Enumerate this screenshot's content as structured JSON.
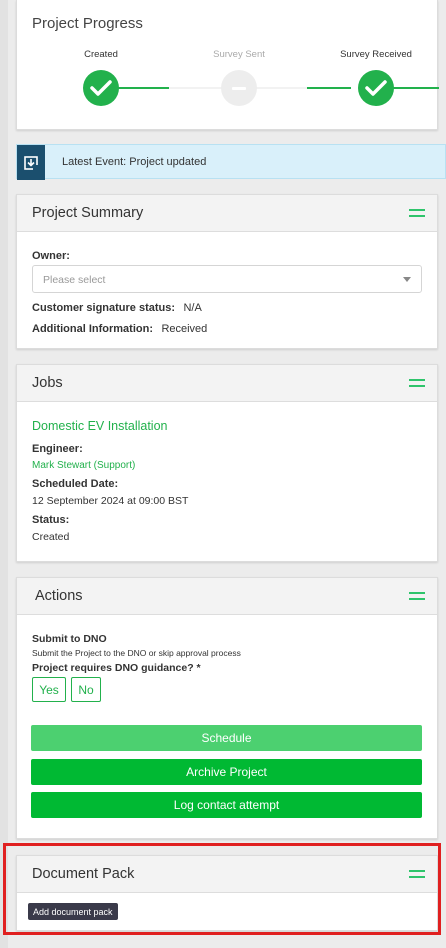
{
  "progress": {
    "title": "Project Progress",
    "steps": [
      {
        "label": "Created",
        "state": "done"
      },
      {
        "label": "Survey Sent",
        "state": "pending"
      },
      {
        "label": "Survey Received",
        "state": "done"
      }
    ]
  },
  "event": {
    "text": "Latest Event: Project updated"
  },
  "summary": {
    "title": "Project Summary",
    "owner_label": "Owner:",
    "owner_placeholder": "Please select",
    "signature_label": "Customer signature status:",
    "signature_value": "N/A",
    "info_label": "Additional Information:",
    "info_value": "Received"
  },
  "jobs": {
    "title": "Jobs",
    "job_name": "Domestic EV Installation",
    "engineer_label": "Engineer:",
    "engineer_value": "Mark Stewart (Support)",
    "date_label": "Scheduled Date:",
    "date_value": "12 September 2024 at 09:00 BST",
    "status_label": "Status:",
    "status_value": "Created"
  },
  "actions": {
    "title": "Actions",
    "dno_title": "Submit to DNO",
    "dno_desc": "Submit the Project to the DNO or skip approval process",
    "dno_question": "Project requires DNO guidance? *",
    "yes_label": "Yes",
    "no_label": "No",
    "schedule_label": "Schedule",
    "archive_label": "Archive Project",
    "log_label": "Log contact attempt"
  },
  "docpack": {
    "title": "Document Pack",
    "add_label": "Add document pack"
  },
  "colors": {
    "accent_green": "#22b14c",
    "light_green": "#4cd070",
    "info_blue": "#d9f0fa",
    "highlight_red": "#e02020"
  }
}
